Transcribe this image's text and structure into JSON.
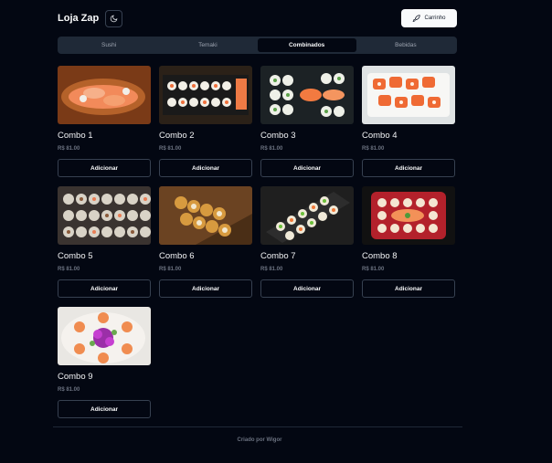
{
  "header": {
    "title": "Loja Zap",
    "theme_icon": "moon-icon",
    "cart_label": "Carrinho",
    "cart_icon": "rocket-icon"
  },
  "tabs": [
    {
      "label": "Sushi",
      "active": false
    },
    {
      "label": "Temaki",
      "active": false
    },
    {
      "label": "Combinados",
      "active": true
    },
    {
      "label": "Bebidas",
      "active": false
    }
  ],
  "products": [
    {
      "name": "Combo 1",
      "price": "R$ 81.00",
      "button": "Adicionar"
    },
    {
      "name": "Combo 2",
      "price": "R$ 81.00",
      "button": "Adicionar"
    },
    {
      "name": "Combo 3",
      "price": "R$ 81.00",
      "button": "Adicionar"
    },
    {
      "name": "Combo 4",
      "price": "R$ 81.00",
      "button": "Adicionar"
    },
    {
      "name": "Combo 5",
      "price": "R$ 81.00",
      "button": "Adicionar"
    },
    {
      "name": "Combo 6",
      "price": "R$ 81.00",
      "button": "Adicionar"
    },
    {
      "name": "Combo 7",
      "price": "R$ 81.00",
      "button": "Adicionar"
    },
    {
      "name": "Combo 8",
      "price": "R$ 81.00",
      "button": "Adicionar"
    },
    {
      "name": "Combo 9",
      "price": "R$ 81.00",
      "button": "Adicionar"
    }
  ],
  "footer": {
    "text": "Criado por Wigor"
  },
  "colors": {
    "background": "#030712",
    "tabs_bg": "#1f2937",
    "border": "#374151",
    "muted_text": "#6b7280"
  }
}
